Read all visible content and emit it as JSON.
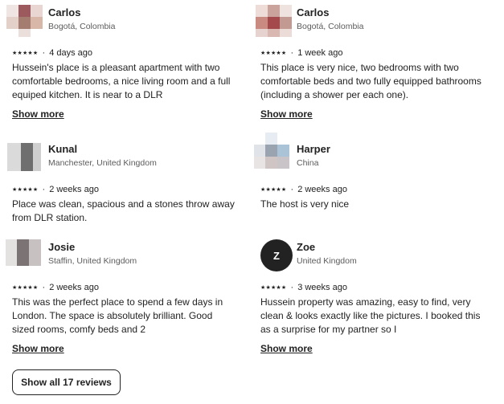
{
  "reviews": [
    {
      "name": "Carlos",
      "location": "Bogotá, Colombia",
      "stars": "★★★★★",
      "when": "4 days ago",
      "text": "Hussein's place is a pleasant apartment with two comfortable bedrooms, a nice living room and a full equiped kitchen. It is near to a DLR",
      "more": "Show more"
    },
    {
      "name": "Carlos",
      "location": "Bogotá, Colombia",
      "stars": "★★★★★",
      "when": "1 week ago",
      "text": "This place is very nice, two bedrooms with two comfortable beds and two fully equipped bathrooms (including a shower per each one).",
      "more": "Show more"
    },
    {
      "name": "Kunal",
      "location": "Manchester, United Kingdom",
      "stars": "★★★★★",
      "when": "2 weeks ago",
      "text": "Place was clean, spacious and a stones throw away from DLR station."
    },
    {
      "name": "Harper",
      "location": "China",
      "stars": "★★★★★",
      "when": "2 weeks ago",
      "text": "The host is very nice"
    },
    {
      "name": "Josie",
      "location": "Staffin, United Kingdom",
      "stars": "★★★★★",
      "when": "2 weeks ago",
      "text": "This was the perfect place to spend a few days in London. The space is absolutely brilliant. Good sized rooms, comfy beds and 2",
      "more": "Show more"
    },
    {
      "name": "Zoe",
      "location": "United Kingdom",
      "avatar_letter": "Z",
      "stars": "★★★★★",
      "when": "3 weeks ago",
      "text": "Hussein property was amazing, easy to find, very clean & looks exactly like the pictures. I booked this as a surprise for my partner so I",
      "more": "Show more"
    }
  ],
  "meta_separator": "·",
  "show_all_label": "Show all 17 reviews"
}
